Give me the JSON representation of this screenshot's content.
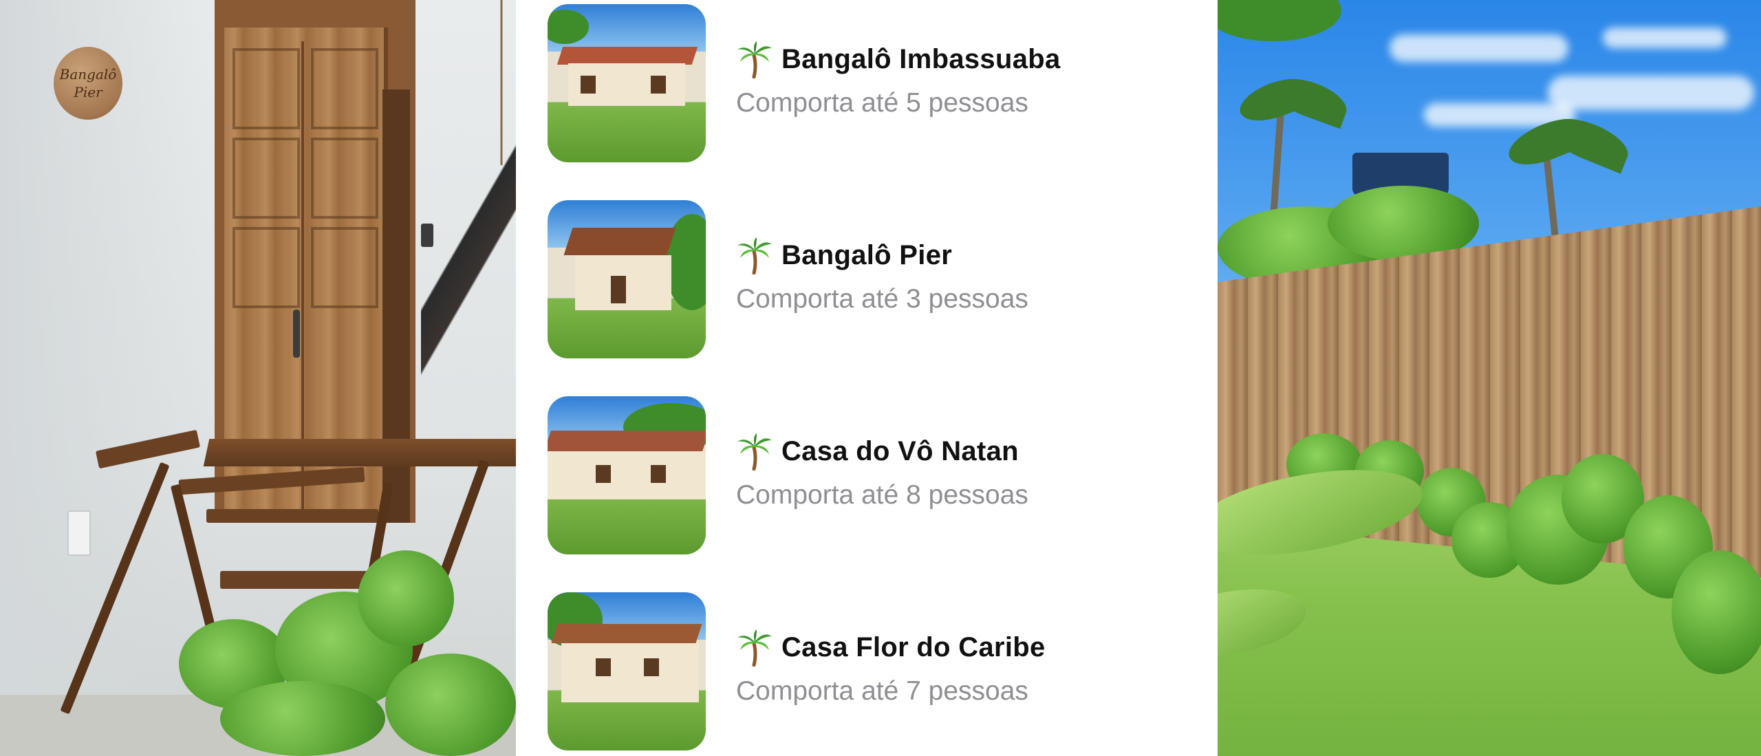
{
  "left_photo": {
    "sign_text_line1": "Bangalô",
    "sign_text_line2": "Pier"
  },
  "accommodations": [
    {
      "icon": "palm-tree",
      "name": "Bangalô Imbassuaba",
      "capacity": "Comporta até 5 pessoas"
    },
    {
      "icon": "palm-tree",
      "name": "Bangalô Pier",
      "capacity": "Comporta até 3 pessoas"
    },
    {
      "icon": "palm-tree",
      "name": "Casa do Vô Natan",
      "capacity": "Comporta até 8 pessoas"
    },
    {
      "icon": "palm-tree",
      "name": "Casa Flor do Caribe",
      "capacity": "Comporta até 7 pessoas"
    }
  ],
  "colors": {
    "title_text": "#111111",
    "subtitle_text": "#8e8e93",
    "background": "#ffffff"
  }
}
